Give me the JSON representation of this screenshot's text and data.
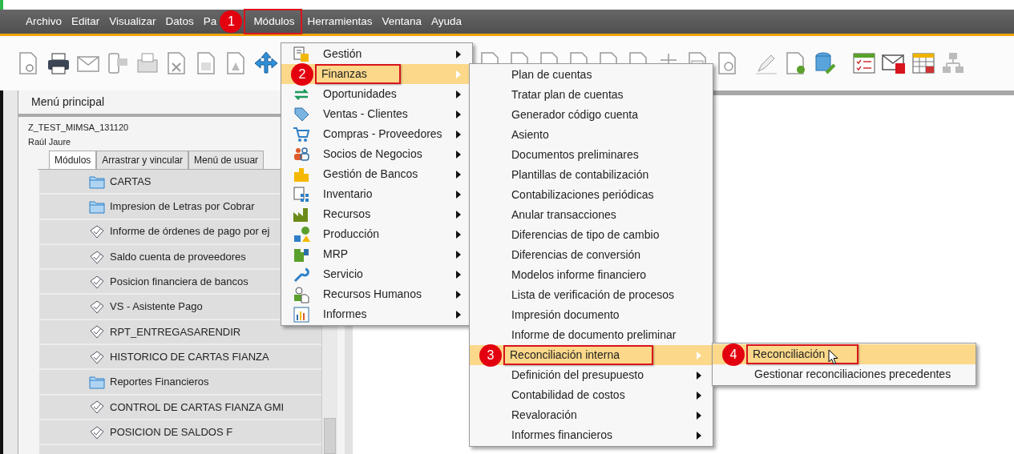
{
  "menubar": [
    {
      "label": "Archivo",
      "highlighted": false
    },
    {
      "label": "Editar",
      "highlighted": false
    },
    {
      "label": "Visualizar",
      "highlighted": false
    },
    {
      "label": "Datos",
      "highlighted": false
    },
    {
      "label": "Pa",
      "highlighted": false
    },
    {
      "label": "Módulos",
      "highlighted": true,
      "badge": "1"
    },
    {
      "label": "Herramientas",
      "highlighted": false
    },
    {
      "label": "Ventana",
      "highlighted": false
    },
    {
      "label": "Ayuda",
      "highlighted": false
    }
  ],
  "left_panel": {
    "title": "Menú principal",
    "company": "Z_TEST_MIMSA_131120",
    "user": "Raúl Jaure",
    "tabs": [
      {
        "label": "Módulos",
        "selected": true
      },
      {
        "label": "Arrastrar y vincular",
        "selected": false
      },
      {
        "label": "Menú de usuar",
        "selected": false
      }
    ],
    "tree": [
      {
        "label": "CARTAS",
        "kind": "folder"
      },
      {
        "label": "Impresion de Letras por Cobrar",
        "kind": "folder"
      },
      {
        "label": "Informe de órdenes de pago por ej",
        "kind": "report"
      },
      {
        "label": "Saldo cuenta de proveedores",
        "kind": "report"
      },
      {
        "label": "Posicion financiera de bancos",
        "kind": "report"
      },
      {
        "label": "VS - Asistente Pago",
        "kind": "report"
      },
      {
        "label": "RPT_ENTREGASARENDIR",
        "kind": "report"
      },
      {
        "label": "HISTORICO DE CARTAS FIANZA",
        "kind": "report"
      },
      {
        "label": "Reportes Financieros",
        "kind": "folder"
      },
      {
        "label": "CONTROL DE CARTAS FIANZA GMI",
        "kind": "report"
      },
      {
        "label": "POSICION DE SALDOS F",
        "kind": "report"
      }
    ]
  },
  "modules_menu": {
    "items": [
      {
        "label": "Gestión",
        "has_submenu": true,
        "selected": false,
        "highlighted": false
      },
      {
        "label": "Finanzas",
        "has_submenu": true,
        "selected": true,
        "highlighted": true,
        "badge": "2"
      },
      {
        "label": "Oportunidades",
        "has_submenu": true,
        "selected": false,
        "highlighted": false
      },
      {
        "label": "Ventas - Clientes",
        "has_submenu": true,
        "selected": false,
        "highlighted": false
      },
      {
        "label": "Compras - Proveedores",
        "has_submenu": true,
        "selected": false,
        "highlighted": false
      },
      {
        "label": "Socios de Negocios",
        "has_submenu": true,
        "selected": false,
        "highlighted": false
      },
      {
        "label": "Gestión de Bancos",
        "has_submenu": true,
        "selected": false,
        "highlighted": false
      },
      {
        "label": "Inventario",
        "has_submenu": true,
        "selected": false,
        "highlighted": false
      },
      {
        "label": "Recursos",
        "has_submenu": true,
        "selected": false,
        "highlighted": false
      },
      {
        "label": "Producción",
        "has_submenu": true,
        "selected": false,
        "highlighted": false
      },
      {
        "label": "MRP",
        "has_submenu": true,
        "selected": false,
        "highlighted": false
      },
      {
        "label": "Servicio",
        "has_submenu": true,
        "selected": false,
        "highlighted": false
      },
      {
        "label": "Recursos Humanos",
        "has_submenu": true,
        "selected": false,
        "highlighted": false
      },
      {
        "label": "Informes",
        "has_submenu": true,
        "selected": false,
        "highlighted": false
      }
    ]
  },
  "finanzas_submenu": {
    "items": [
      {
        "label": "Plan de cuentas",
        "has_submenu": false,
        "selected": false,
        "highlighted": false
      },
      {
        "label": "Tratar plan de cuentas",
        "has_submenu": false,
        "selected": false,
        "highlighted": false
      },
      {
        "label": "Generador código cuenta",
        "has_submenu": false,
        "selected": false,
        "highlighted": false
      },
      {
        "label": "Asiento",
        "has_submenu": false,
        "selected": false,
        "highlighted": false
      },
      {
        "label": "Documentos preliminares",
        "has_submenu": false,
        "selected": false,
        "highlighted": false
      },
      {
        "label": "Plantillas de contabilización",
        "has_submenu": false,
        "selected": false,
        "highlighted": false
      },
      {
        "label": "Contabilizaciones periódicas",
        "has_submenu": false,
        "selected": false,
        "highlighted": false
      },
      {
        "label": "Anular transacciones",
        "has_submenu": false,
        "selected": false,
        "highlighted": false
      },
      {
        "label": "Diferencias de tipo de cambio",
        "has_submenu": false,
        "selected": false,
        "highlighted": false
      },
      {
        "label": "Diferencias de conversión",
        "has_submenu": false,
        "selected": false,
        "highlighted": false
      },
      {
        "label": "Modelos informe financiero",
        "has_submenu": false,
        "selected": false,
        "highlighted": false
      },
      {
        "label": "Lista de verificación de procesos",
        "has_submenu": false,
        "selected": false,
        "highlighted": false
      },
      {
        "label": "Impresión documento",
        "has_submenu": false,
        "selected": false,
        "highlighted": false
      },
      {
        "label": "Informe de documento preliminar",
        "has_submenu": false,
        "selected": false,
        "highlighted": false
      },
      {
        "label": "Reconciliación interna",
        "has_submenu": true,
        "selected": true,
        "highlighted": true,
        "badge": "3"
      },
      {
        "label": "Definición del presupuesto",
        "has_submenu": true,
        "selected": false,
        "highlighted": false
      },
      {
        "label": "Contabilidad de costos",
        "has_submenu": true,
        "selected": false,
        "highlighted": false
      },
      {
        "label": "Revaloración",
        "has_submenu": true,
        "selected": false,
        "highlighted": false
      },
      {
        "label": "Informes financieros",
        "has_submenu": true,
        "selected": false,
        "highlighted": false
      }
    ]
  },
  "reconciliacion_submenu": {
    "items": [
      {
        "label": "Reconciliación",
        "has_submenu": false,
        "selected": true,
        "highlighted": true,
        "badge": "4"
      },
      {
        "label": "Gestionar reconciliaciones precedentes",
        "has_submenu": false,
        "selected": false,
        "highlighted": false
      }
    ]
  }
}
